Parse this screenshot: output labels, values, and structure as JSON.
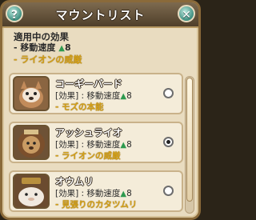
{
  "window": {
    "title": "マウントリスト",
    "help_label": "?",
    "close_label": "✕"
  },
  "summary": {
    "heading": "適用中の効果",
    "line1_label": "- 移動速度",
    "line1_arrow": "▲",
    "line1_value": "8",
    "line2_label": "- ライオンの威厳"
  },
  "mounts": [
    {
      "name": "コーギーバード",
      "effect_label": "[効果] : 移動速度",
      "arrow": "▲",
      "value": "8",
      "ability": "- モズの本能",
      "selected": false
    },
    {
      "name": "アッシュライオ",
      "effect_label": "[効果] : 移動速度",
      "arrow": "▲",
      "value": "8",
      "ability": "- ライオンの威厳",
      "selected": true
    },
    {
      "name": "オウムリ",
      "effect_label": "[効果] : 移動速度",
      "arrow": "▲",
      "value": "8",
      "ability": "- 見張りのカタツムリ",
      "selected": false
    }
  ],
  "colors": {
    "accent_gold": "#d4a017",
    "up_green": "#2e9a4f"
  }
}
